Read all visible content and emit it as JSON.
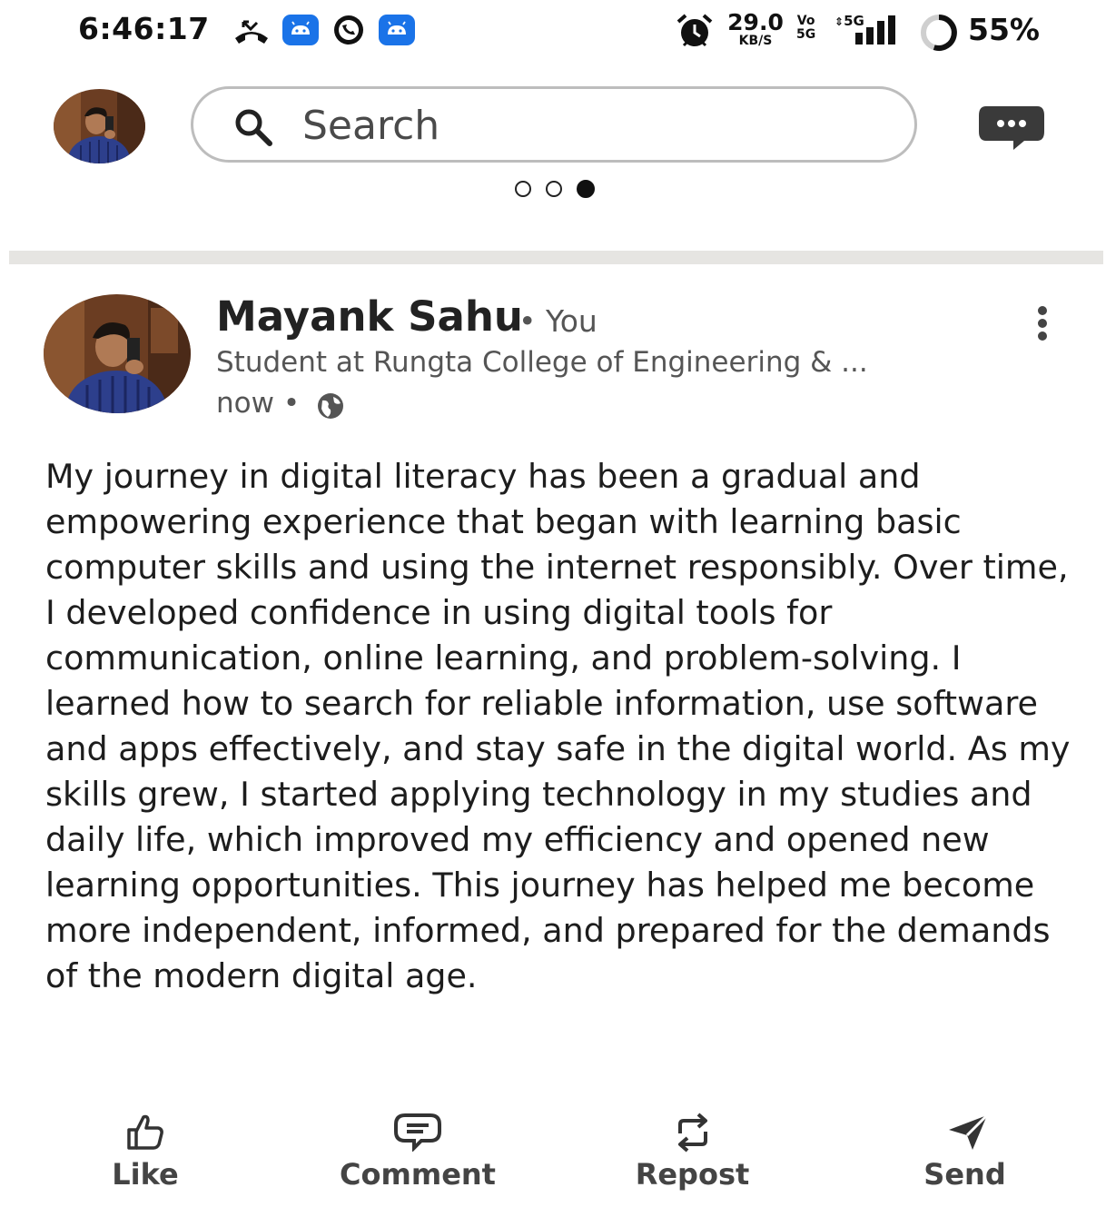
{
  "status_bar": {
    "time": "6:46:17",
    "net_speed_value": "29.0",
    "net_speed_unit": "KB/S",
    "volte_top": "Vo",
    "volte_bottom": "5G",
    "network_type": "5G",
    "battery_percent": "55%"
  },
  "header": {
    "search_placeholder": "Search",
    "pager": {
      "count": 3,
      "active_index": 2
    }
  },
  "post": {
    "author_name": "Mayank Sahu",
    "author_relation": "• You",
    "author_headline": "Student at Rungta College of Engineering & ...",
    "timestamp": "now •",
    "body": "My journey in digital literacy has been a gradual and empowering experience that began with learning basic computer skills and using the internet responsibly. Over time, I developed confidence in using digital tools for communication, online learning, and problem-solving. I learned how to search for reliable information, use software and apps effectively, and stay safe in the digital world. As my skills grew, I started applying technology in my studies and daily life, which improved my efficiency and opened new learning opportunities. This journey has helped me become more independent, informed, and prepared for the demands of the modern digital age."
  },
  "actions": {
    "like": "Like",
    "comment": "Comment",
    "repost": "Repost",
    "send": "Send"
  },
  "colors": {
    "app_badge": "#1a73e8",
    "divider": "#e6e5e2",
    "icon_dark": "#333333"
  }
}
